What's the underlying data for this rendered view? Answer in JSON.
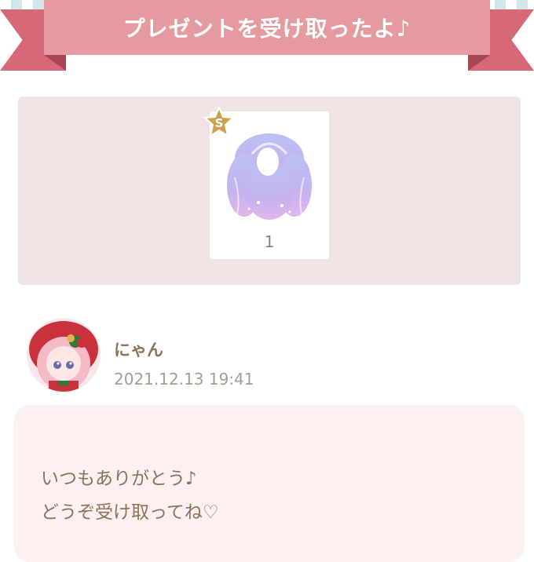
{
  "header": {
    "title": "プレゼントを受け取ったよ♪"
  },
  "gift": {
    "rank": "S",
    "quantity": "1",
    "item_icon": "purple-twin-tail-hair-icon"
  },
  "sender": {
    "name": "にゃん",
    "timestamp": "2021.12.13 19:41",
    "avatar_icon": "avatar-icon"
  },
  "message": {
    "lines": [
      "いつもありがとう♪",
      "どうぞ受け取ってね♡"
    ]
  },
  "colors": {
    "ribbon": "#e49a9f",
    "ribbon_tail": "#d66878",
    "gift_box_bg": "#f1e2e4",
    "message_bg": "#fcf0f1",
    "text_brown": "#8b7358",
    "text_gray": "#a59d94",
    "badge_gold": "#c9a24a"
  }
}
